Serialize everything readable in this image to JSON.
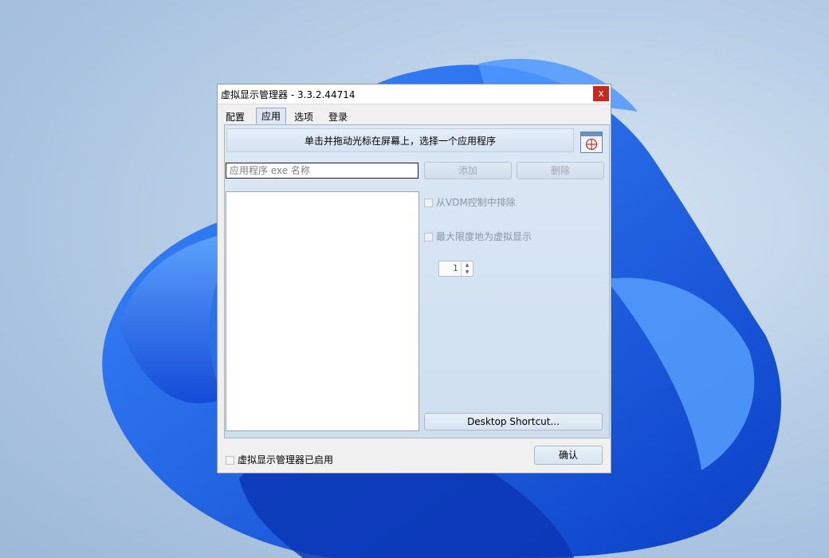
{
  "window": {
    "title": "虚拟显示管理器 - 3.3.2.44714",
    "close_glyph": "x"
  },
  "tabs": [
    {
      "label": "配置",
      "active": false
    },
    {
      "label": "应用",
      "active": true
    },
    {
      "label": "选项",
      "active": false
    },
    {
      "label": "登录",
      "active": false
    }
  ],
  "panel": {
    "hint": "单击并拖动光标在屏幕上，选择一个应用程序",
    "target_icon": "crosshair-icon",
    "app_input": {
      "value": "",
      "placeholder": "应用程序 exe 名称"
    },
    "add_label": "添加",
    "delete_label": "删除",
    "exclude_label": "从VDM控制中排除",
    "maximize_label": "最大限度地为虚拟显示",
    "spinner_value": "1",
    "desktop_shortcut_label": "Desktop Shortcut..."
  },
  "footer": {
    "enabled_label": "虚拟显示管理器已启用",
    "ok_label": "确认"
  },
  "colors": {
    "close_red": "#c42b1c",
    "panel_blue": "#d3e2f2",
    "wallpaper_blue": "#1f5fe0"
  }
}
